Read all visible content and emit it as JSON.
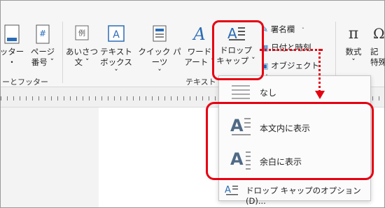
{
  "ribbon": {
    "buttons": {
      "footer": {
        "line1": "ッター",
        "line2": "・"
      },
      "page_number": {
        "line1": "ページ",
        "line2": "番号 ˇ"
      },
      "greeting": {
        "line1": "あいさつ",
        "line2": "文 ˇ"
      },
      "textbox": {
        "line1": "テキスト",
        "line2": "ボックス ˇ"
      },
      "quick_parts": {
        "line1": "クイック パーツ",
        "line2": "ˇ"
      },
      "wordart": {
        "line1": "ワード",
        "line2": "アート ˇ"
      },
      "dropcap": {
        "line1": "ドロップ",
        "line2": "キャップ ˇ"
      },
      "signature_line": {
        "label": "署名欄",
        "caret": "ˇ"
      },
      "datetime": {
        "label": "日付と時刻"
      },
      "object": {
        "label": "オブジェクト",
        "caret": "ˇ"
      },
      "equation": {
        "line1": "数式",
        "line2": "ˇ"
      },
      "special": {
        "line1": "記",
        "line2": "特殊"
      }
    },
    "groups": {
      "header_footer": "ーとフッター",
      "text": "テキスト"
    }
  },
  "dropdown": {
    "items": [
      {
        "label": "なし"
      },
      {
        "label": "本文内に表示"
      },
      {
        "label": "余白に表示"
      },
      {
        "label": "ドロップ キャップのオプション(D)..."
      }
    ]
  },
  "colors": {
    "accent": "#e60012",
    "icon_blue": "#2b6cb6"
  }
}
